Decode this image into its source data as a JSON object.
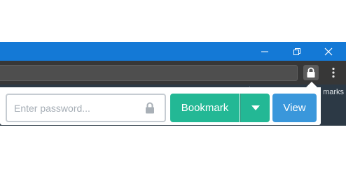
{
  "window": {
    "minimize_icon": "minimize-icon",
    "restore_icon": "restore-icon",
    "close_icon": "close-icon",
    "titlebar_color": "#1479d6"
  },
  "toolbar": {
    "extension_icon": "lock-icon",
    "menu_icon": "more-vertical-icon"
  },
  "bookmarks_bar": {
    "label": "Bookmarks"
  },
  "popup": {
    "password_placeholder": "Enter password...",
    "password_value": "",
    "bookmark_label": "Bookmark",
    "view_label": "View",
    "colors": {
      "bookmark": "#23b895",
      "view": "#3a97db"
    }
  }
}
